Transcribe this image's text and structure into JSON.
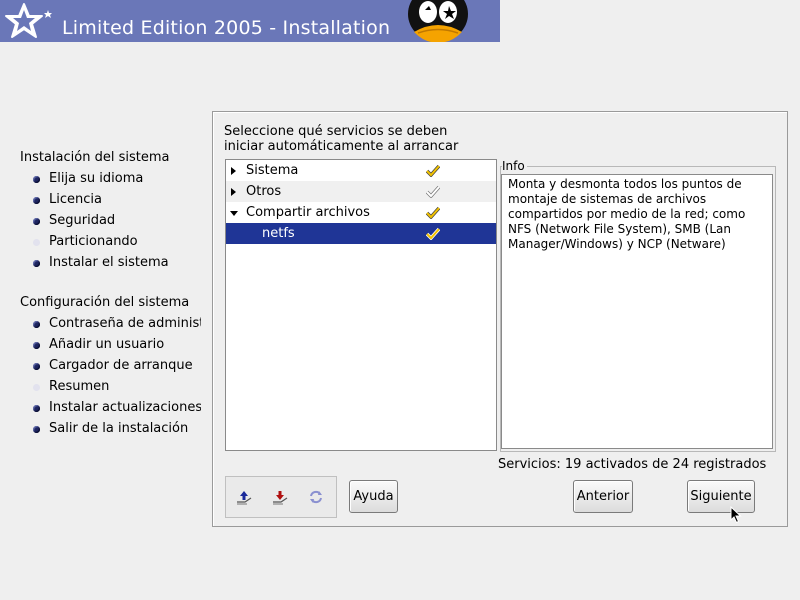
{
  "banner": {
    "title": "Limited Edition 2005 - Installation"
  },
  "steps": {
    "group1_title": "Instalación del sistema",
    "group1_items": [
      {
        "label": "Elija su idioma",
        "state": "done"
      },
      {
        "label": "Licencia",
        "state": "done"
      },
      {
        "label": "Seguridad",
        "state": "done"
      },
      {
        "label": "Particionando",
        "state": "pending"
      },
      {
        "label": "Instalar el sistema",
        "state": "done"
      }
    ],
    "group2_title": "Configuración del sistema",
    "group2_items": [
      {
        "label": "Contraseña de administi",
        "state": "done"
      },
      {
        "label": "Añadir un usuario",
        "state": "done"
      },
      {
        "label": "Cargador de arranque",
        "state": "done"
      },
      {
        "label": "Resumen",
        "state": "pending"
      },
      {
        "label": "Instalar actualizaciones",
        "state": "done"
      },
      {
        "label": "Salir de la instalación",
        "state": "done"
      }
    ]
  },
  "panel": {
    "prompt": "Seleccione qué servicios se deben iniciar automáticamente al arrancar",
    "services": [
      {
        "label": "Sistema",
        "expanded": false,
        "level": 0,
        "checked": "full"
      },
      {
        "label": "Otros",
        "expanded": false,
        "level": 0,
        "checked": "partial"
      },
      {
        "label": "Compartir archivos",
        "expanded": true,
        "level": 0,
        "checked": "full"
      },
      {
        "label": "netfs",
        "level": 1,
        "checked": "full",
        "selected": true
      }
    ],
    "info_title": "Info",
    "info_text": "Monta y desmonta todos los puntos de montaje de sistemas de archivos compartidos por medio de la red; como NFS (Network File System), SMB (Lan Manager/Windows) y NCP (Netware)",
    "status": "Servicios: 19 activados de 24 registrados",
    "buttons": {
      "help": "Ayuda",
      "back": "Anterior",
      "next": "Siguiente"
    }
  },
  "colors": {
    "banner": "#6a77b8",
    "selection": "#1f3596",
    "check": "#e8b800"
  }
}
